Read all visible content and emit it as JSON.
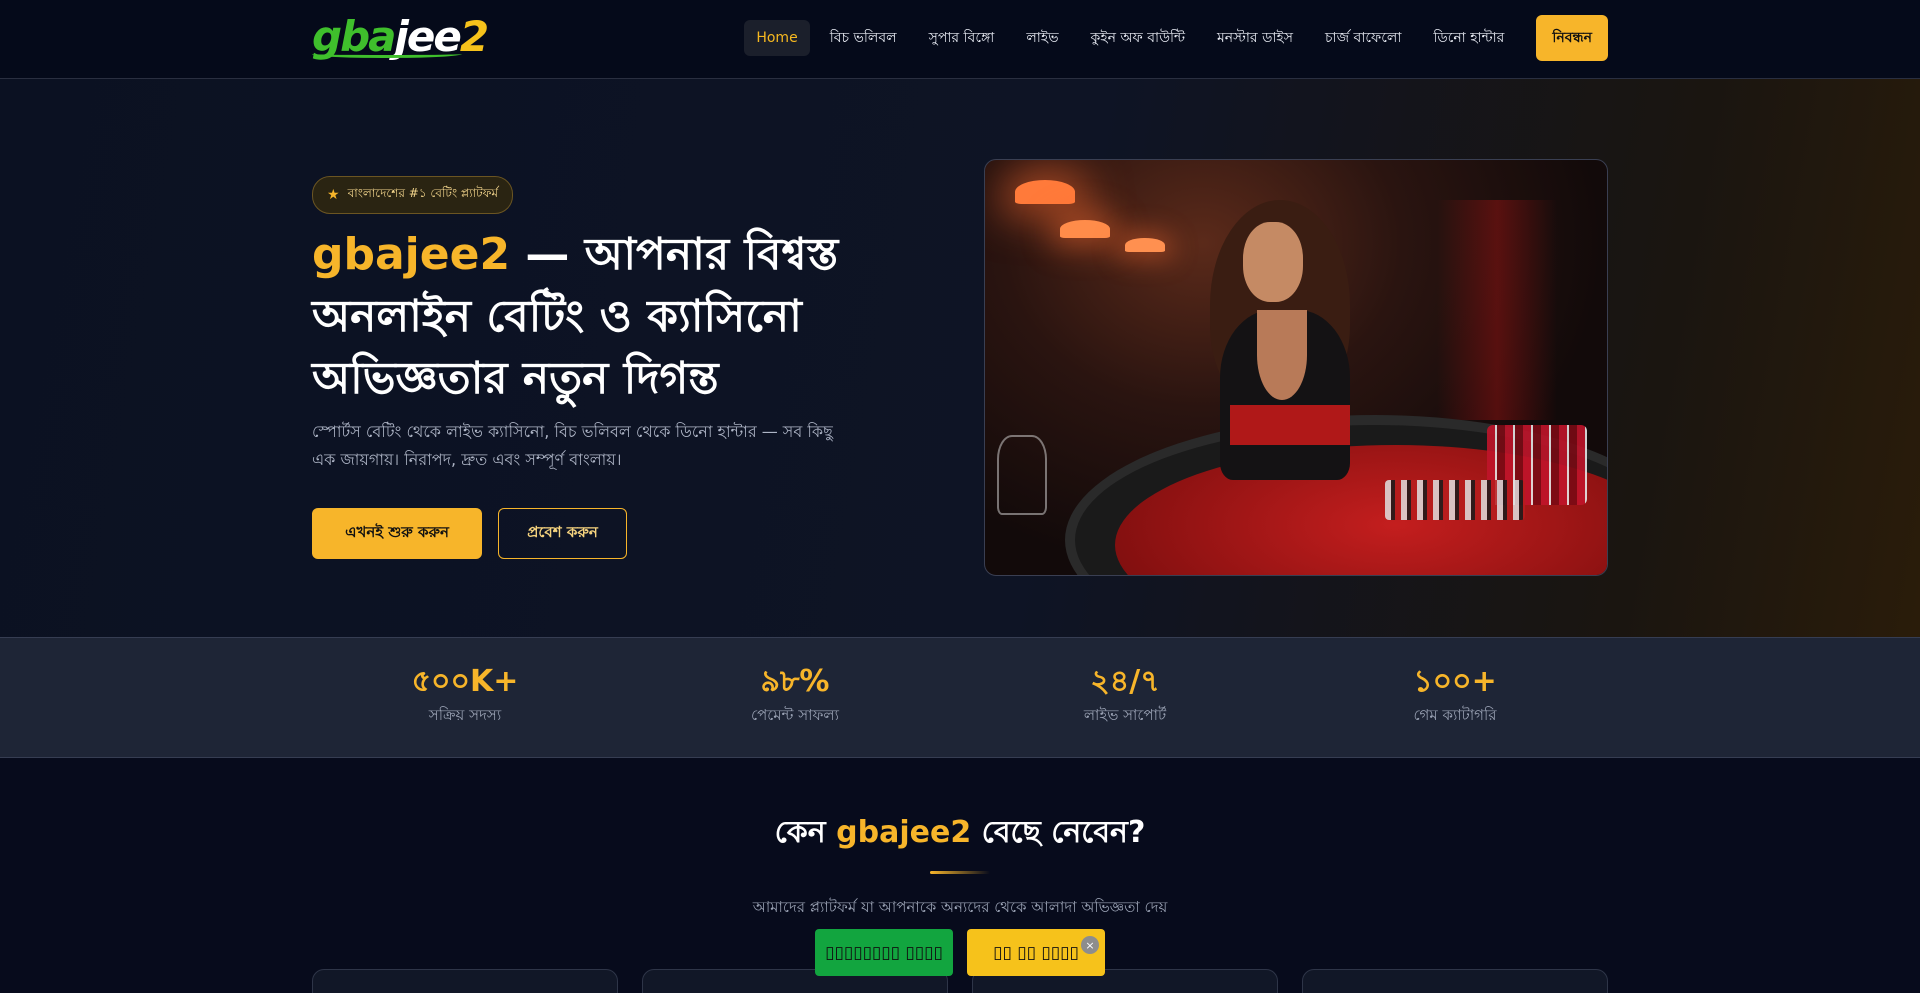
{
  "header": {
    "logo": {
      "part1": "gba",
      "part2": "jee",
      "part3": "2"
    },
    "nav": [
      {
        "label": "Home",
        "active": true
      },
      {
        "label": "বিচ ভলিবল"
      },
      {
        "label": "সুপার বিঙ্গো"
      },
      {
        "label": "লাইভ"
      },
      {
        "label": "কুইন অফ বাউন্টি"
      },
      {
        "label": "মনস্টার ডাইস"
      },
      {
        "label": "চার্জ বাফেলো"
      },
      {
        "label": "ডিনো হান্টার"
      }
    ],
    "register_label": "নিবন্ধন"
  },
  "hero": {
    "badge": "বাংলাদেশের #১ বেটিং প্ল্যাটফর্ম",
    "title_brand": "gbajee2",
    "title_rest": "— আপনার বিশ্বস্ত অনলাইন বেটিং ও ক্যাসিনো অভিজ্ঞতার নতুন দিগন্ত",
    "subtitle": "স্পোর্টস বেটিং থেকে লাইভ ক্যাসিনো, বিচ ভলিবল থেকে ডিনো হান্টার — সব কিছু এক জায়গায়। নিরাপদ, দ্রুত এবং সম্পূর্ণ বাংলায়।",
    "primary_button": "এখনই শুরু করুন",
    "secondary_button": "প্রবেশ করুন"
  },
  "stats": [
    {
      "value": "৫০০K+",
      "label": "সক্রিয় সদস্য"
    },
    {
      "value": "৯৮%",
      "label": "পেমেন্ট সাফল্য"
    },
    {
      "value": "২৪/৭",
      "label": "লাইভ সাপোর্ট"
    },
    {
      "value": "১০০+",
      "label": "গেম ক্যাটাগরি"
    }
  ],
  "why": {
    "title_prefix": "কেন",
    "title_brand": "gbajee2",
    "title_suffix": "বেছে নেবেন?",
    "subtitle": "আমাদের প্ল্যাটফর্ম যা আপনাকে অন্যদের থেকে আলাদা অভিজ্ঞতা দেয়"
  },
  "floating_bar": {
    "green_label": "▯▯▯▯▯▯▯▯ ▯▯▯▯",
    "yellow_label": "▯▯ ▯▯ ▯▯▯▯",
    "close_icon": "×"
  },
  "colors": {
    "accent": "#f7b52a",
    "background": "#070b1c",
    "stats_bg": "#1e2536",
    "green": "#12a53f"
  }
}
